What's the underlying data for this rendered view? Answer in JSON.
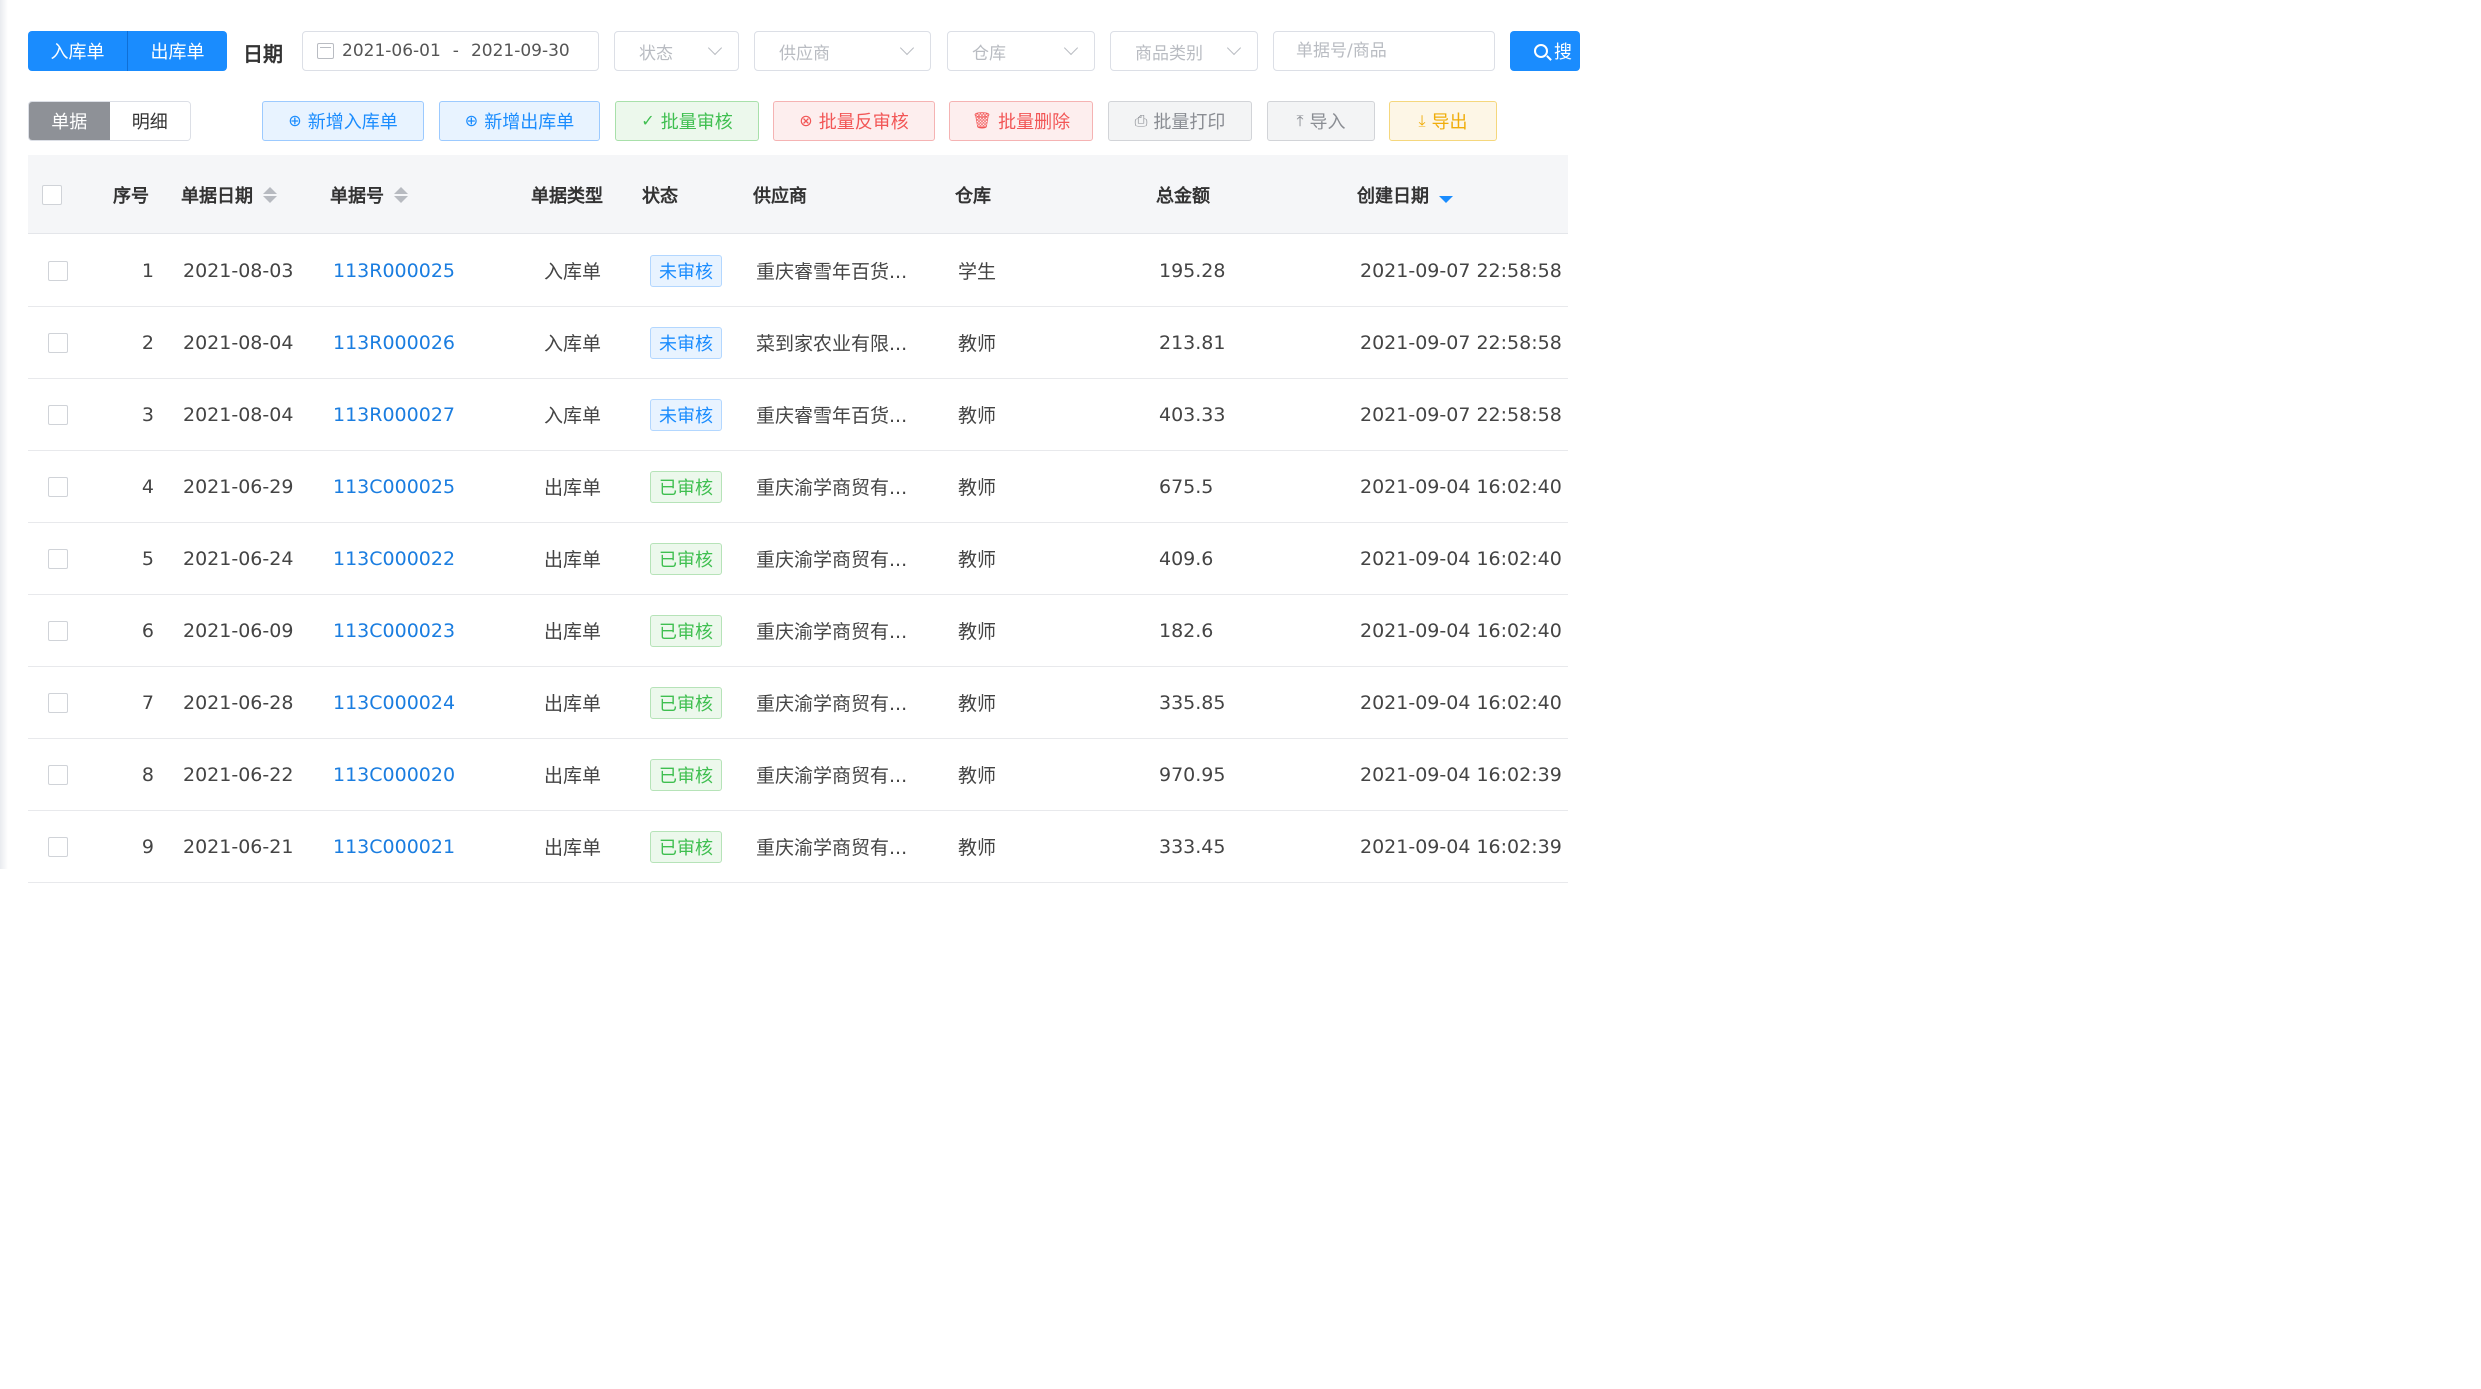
{
  "filters": {
    "doc_type_tabs": [
      "入库单",
      "出库单"
    ],
    "date_label": "日期",
    "date_start": "2021-06-01",
    "date_sep": "-",
    "date_end": "2021-09-30",
    "status_placeholder": "状态",
    "supplier_placeholder": "供应商",
    "warehouse_placeholder": "仓库",
    "category_placeholder": "商品类别",
    "search_placeholder": "单据号/商品",
    "search_button_label": "搜"
  },
  "toolbar": {
    "view_tabs": [
      "单据",
      "明细"
    ],
    "active_view": "单据",
    "buttons": [
      {
        "label": "新增入库单",
        "icon": "plus-circle-icon",
        "glyph": "⊕"
      },
      {
        "label": "新增出库单",
        "icon": "plus-circle-icon",
        "glyph": "⊕"
      },
      {
        "label": "批量审核",
        "icon": "check-circle-icon",
        "glyph": "✓"
      },
      {
        "label": "批量反审核",
        "icon": "x-circle-icon",
        "glyph": "⊗"
      },
      {
        "label": "批量删除",
        "icon": "trash-icon",
        "glyph": "🗑"
      },
      {
        "label": "批量打印",
        "icon": "printer-icon",
        "glyph": "⎙"
      },
      {
        "label": "导入",
        "icon": "upload-icon",
        "glyph": "⤒"
      },
      {
        "label": "导出",
        "icon": "download-icon",
        "glyph": "⤓"
      }
    ]
  },
  "table": {
    "columns": [
      "序号",
      "单据日期",
      "单据号",
      "单据类型",
      "状态",
      "供应商",
      "仓库",
      "总金额",
      "创建日期"
    ],
    "rows": [
      {
        "idx": "1",
        "date": "2021-08-03",
        "no": "113R000025",
        "type": "入库单",
        "status": "未审核",
        "supplier": "重庆睿雪年百货...",
        "warehouse": "学生",
        "amount": "195.28",
        "created": "2021-09-07 22:58:58"
      },
      {
        "idx": "2",
        "date": "2021-08-04",
        "no": "113R000026",
        "type": "入库单",
        "status": "未审核",
        "supplier": "菜到家农业有限...",
        "warehouse": "教师",
        "amount": "213.81",
        "created": "2021-09-07 22:58:58"
      },
      {
        "idx": "3",
        "date": "2021-08-04",
        "no": "113R000027",
        "type": "入库单",
        "status": "未审核",
        "supplier": "重庆睿雪年百货...",
        "warehouse": "教师",
        "amount": "403.33",
        "created": "2021-09-07 22:58:58"
      },
      {
        "idx": "4",
        "date": "2021-06-29",
        "no": "113C000025",
        "type": "出库单",
        "status": "已审核",
        "supplier": "重庆渝学商贸有...",
        "warehouse": "教师",
        "amount": "675.5",
        "created": "2021-09-04 16:02:40"
      },
      {
        "idx": "5",
        "date": "2021-06-24",
        "no": "113C000022",
        "type": "出库单",
        "status": "已审核",
        "supplier": "重庆渝学商贸有...",
        "warehouse": "教师",
        "amount": "409.6",
        "created": "2021-09-04 16:02:40"
      },
      {
        "idx": "6",
        "date": "2021-06-09",
        "no": "113C000023",
        "type": "出库单",
        "status": "已审核",
        "supplier": "重庆渝学商贸有...",
        "warehouse": "教师",
        "amount": "182.6",
        "created": "2021-09-04 16:02:40"
      },
      {
        "idx": "7",
        "date": "2021-06-28",
        "no": "113C000024",
        "type": "出库单",
        "status": "已审核",
        "supplier": "重庆渝学商贸有...",
        "warehouse": "教师",
        "amount": "335.85",
        "created": "2021-09-04 16:02:40"
      },
      {
        "idx": "8",
        "date": "2021-06-22",
        "no": "113C000020",
        "type": "出库单",
        "status": "已审核",
        "supplier": "重庆渝学商贸有...",
        "warehouse": "教师",
        "amount": "970.95",
        "created": "2021-09-04 16:02:39"
      },
      {
        "idx": "9",
        "date": "2021-06-21",
        "no": "113C000021",
        "type": "出库单",
        "status": "已审核",
        "supplier": "重庆渝学商贸有...",
        "warehouse": "教师",
        "amount": "333.45",
        "created": "2021-09-04 16:02:39"
      }
    ]
  },
  "colors": {
    "primary": "#1a8cfe",
    "success": "#3fbf50",
    "danger": "#f25656",
    "warning": "#f0ad0a",
    "link": "#1a7de0"
  }
}
